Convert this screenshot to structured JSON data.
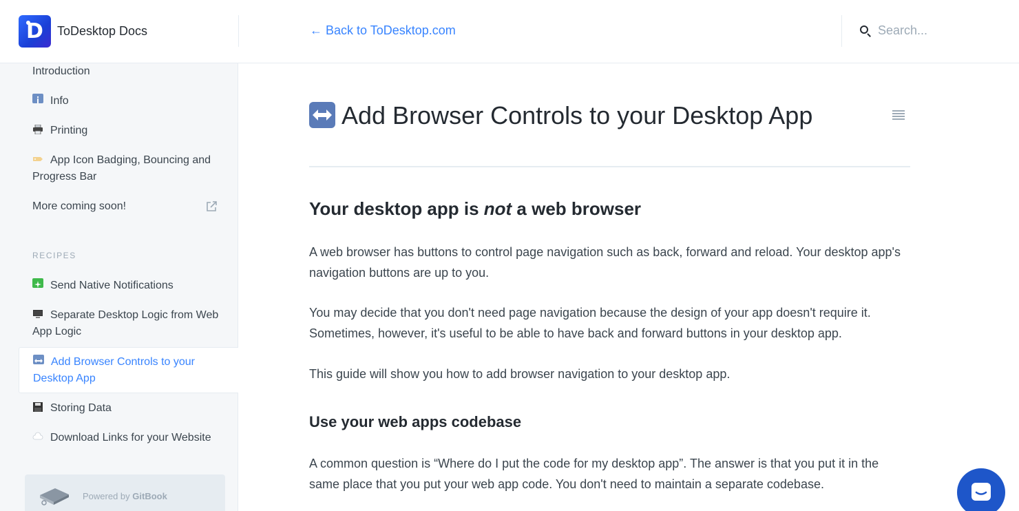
{
  "header": {
    "brand_name": "ToDesktop Docs",
    "logo_letter": "D",
    "back_link": "← Back to ToDesktop.com",
    "search_placeholder": "Search..."
  },
  "sidebar": {
    "items_top": [
      {
        "label": "Introduction",
        "icon": "none"
      },
      {
        "label": "Info",
        "icon": "info-icon"
      },
      {
        "label": "Printing",
        "icon": "printer-icon"
      },
      {
        "label": "App Icon Badging, Bouncing and Progress Bar",
        "icon": "label-tag-icon"
      },
      {
        "label": "More coming soon!",
        "icon": "external-link-icon"
      }
    ],
    "section_title": "RECIPES",
    "items_recipes": [
      {
        "label": "Send Native Notifications",
        "icon": "sparkle-plus-icon"
      },
      {
        "label": "Separate Desktop Logic from Web App Logic",
        "icon": "monitor-icon"
      },
      {
        "label": "Add Browser Controls to your Desktop App",
        "icon": "left-right-arrow-icon",
        "active": true
      },
      {
        "label": "Storing Data",
        "icon": "floppy-disk-icon"
      },
      {
        "label": "Download Links for your Website",
        "icon": "cloud-icon"
      }
    ],
    "powered_by": "Powered by",
    "gitbook": "GitBook"
  },
  "main": {
    "title": "Add Browser Controls to your Desktop App",
    "h2_before": "Your desktop app is ",
    "h2_em": "not",
    "h2_after": " a web browser",
    "paragraphs": [
      "A web browser has buttons to control page navigation such as back, forward and reload. Your desktop app's navigation buttons are up to you.",
      "You may decide that you don't need page navigation because the design of your app doesn't require it. Sometimes, however, it's useful to be able to have back and forward buttons in your desktop app.",
      "This guide will show you how to add browser navigation to your desktop app."
    ],
    "h3": "Use your web apps codebase",
    "paragraph_after_h3": "A common question is “Where do I put the code for my desktop app”. The answer is that you put it in the same place that you put your web app code. You don't need to maintain a separate codebase."
  },
  "colors": {
    "accent": "#3884ff",
    "text": "#242a31",
    "muted": "#9daab6",
    "sidebar_bg": "#f5f7f9",
    "chat_bg": "#1e56c9"
  }
}
